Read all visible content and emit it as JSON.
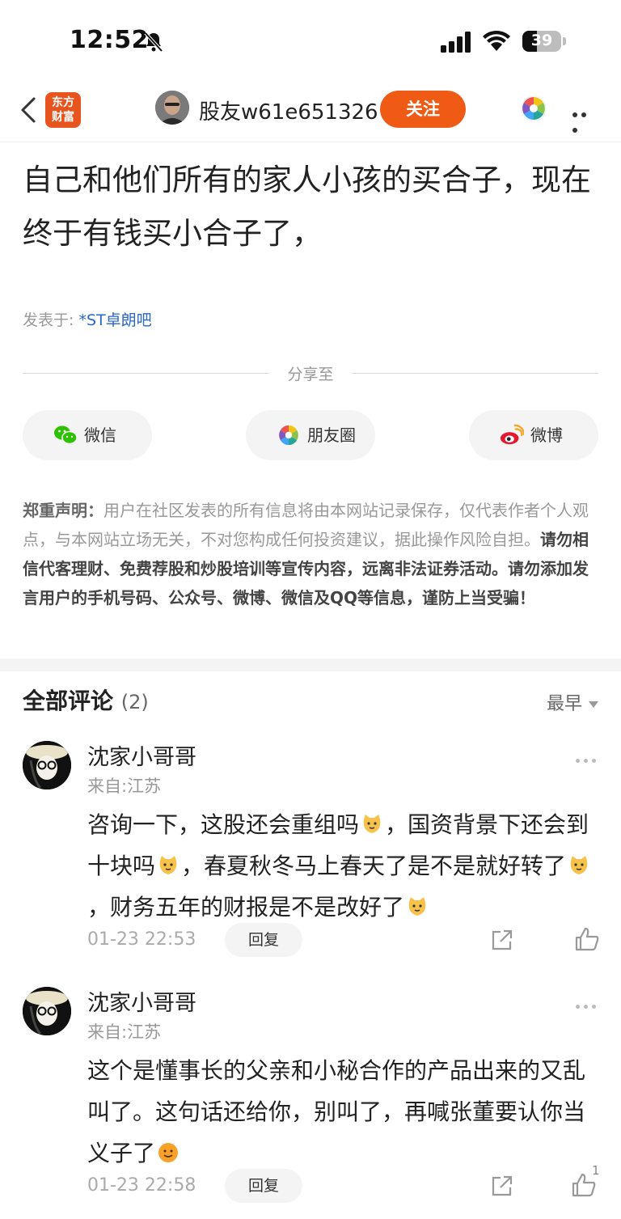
{
  "status": {
    "time": "12:52",
    "battery": "39"
  },
  "nav": {
    "logo_line1": "东方",
    "logo_line2": "财富",
    "username": "股友w61e651326",
    "follow": "关注"
  },
  "post": {
    "text": "自己和他们所有的家人小孩的买合子，现在终于有钱买小合子了，",
    "source_label": "发表于: ",
    "source_link": "*ST卓朗吧"
  },
  "share": {
    "title": "分享至",
    "wechat": "微信",
    "moments": "朋友圈",
    "weibo": "微博"
  },
  "disclaimer": {
    "label": "郑重声明：",
    "normal": "用户在社区发表的所有信息将由本网站记录保存，仅代表作者个人观点，与本网站立场无关，不对您构成任何投资建议，据此操作风险自担。",
    "bold": "请勿相信代客理财、免费荐股和炒股培训等宣传内容，远离非法证券活动。请勿添加发言用户的手机号码、公众号、微博、微信及QQ等信息，谨防上当受骗！"
  },
  "comments": {
    "title": "全部评论",
    "count": "(2)",
    "sort": "最早",
    "items": [
      {
        "name": "沈家小哥哥",
        "from": "来自:江苏",
        "parts": [
          "咨询一下，这股还会重组吗",
          "，国资背景下还会到十块吗",
          "，春夏秋冬马上春天了是不是就好转了",
          "，财务五年的财报是不是改好了"
        ],
        "time": "01-23 22:53",
        "reply": "回复",
        "likes": ""
      },
      {
        "name": "沈家小哥哥",
        "from": "来自:江苏",
        "parts": [
          "这个是懂事长的父亲和小秘合作的产品出来的又乱叫了。这句话还给你，别叫了，再喊张董要认你当义子了"
        ],
        "time": "01-23 22:58",
        "reply": "回复",
        "likes": "1"
      }
    ]
  },
  "colors": {
    "accent": "#ef5a14",
    "link": "#2a67c9"
  }
}
